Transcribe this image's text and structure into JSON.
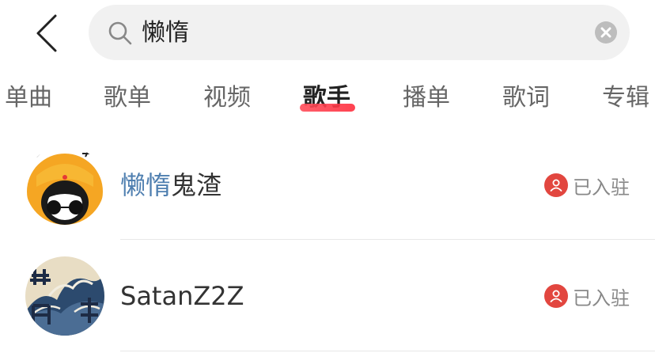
{
  "search": {
    "query": "懒惰"
  },
  "tabs": [
    {
      "label": "单曲"
    },
    {
      "label": "歌单"
    },
    {
      "label": "视频"
    },
    {
      "label": "歌手"
    },
    {
      "label": "播单"
    },
    {
      "label": "歌词"
    },
    {
      "label": "专辑"
    }
  ],
  "active_tab": "歌手",
  "artists": [
    {
      "name_highlight": "懒惰",
      "name_rest": "鬼渣",
      "badge": "已入驻",
      "avatar_icon": "cartoon-avatar-icon"
    },
    {
      "name_highlight": "",
      "name_rest": "SatanZ2Z",
      "badge": "已入驻",
      "avatar_icon": "wave-art-avatar-icon"
    }
  ],
  "colors": {
    "accent": "#ff2d3d",
    "highlight": "#4f7fb0",
    "badge": "#e2463f"
  }
}
